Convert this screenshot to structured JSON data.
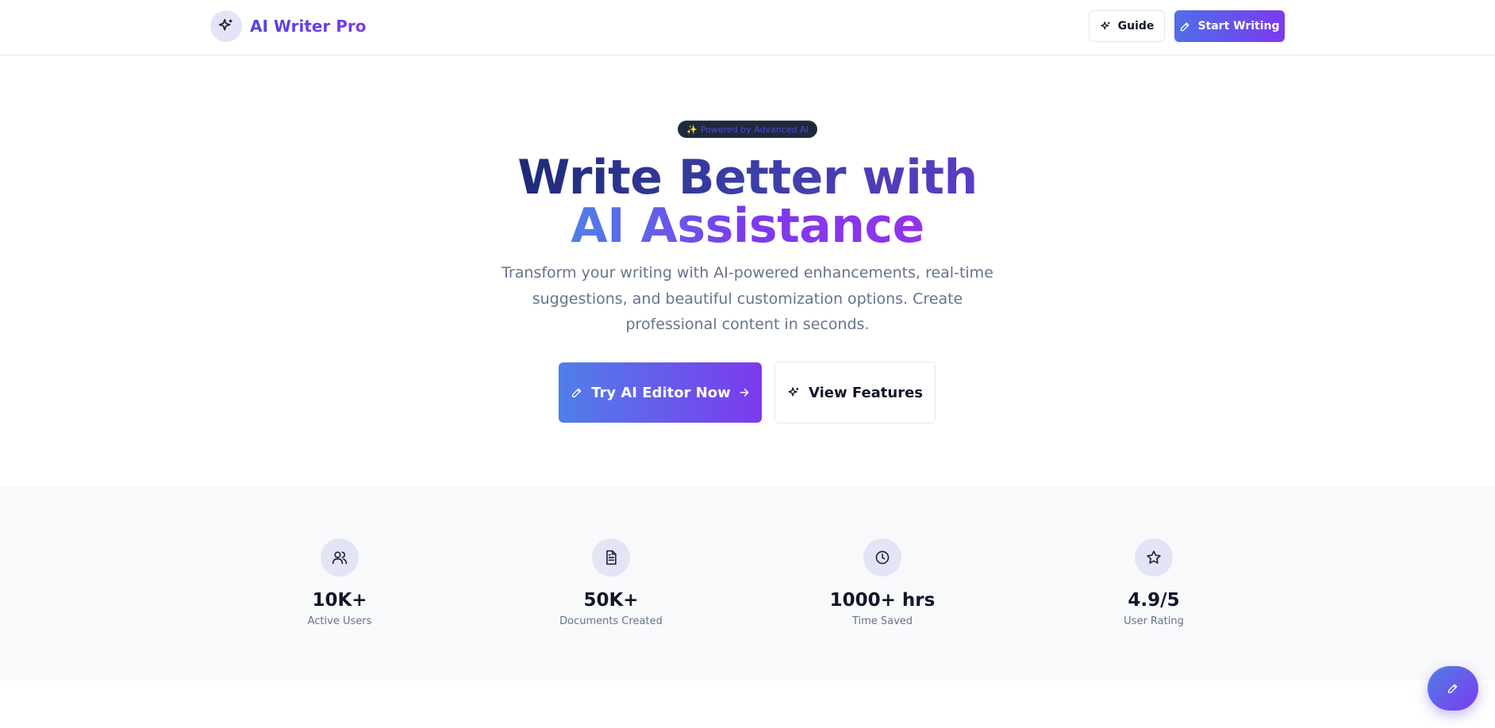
{
  "header": {
    "brand_name": "AI Writer Pro",
    "brand_icon": "sparkles-icon",
    "guide_label": "Guide",
    "guide_icon": "sparkles-icon",
    "start_label": "Start Writing",
    "start_icon": "pen-icon"
  },
  "hero": {
    "badge_icon": "✨",
    "badge_text": "Powered by Advanced AI",
    "title_line1": "Write Better with",
    "title_line2": "AI Assistance",
    "subtitle": "Transform your writing with AI-powered enhancements, real-time suggestions, and beautiful customization options. Create professional content in seconds.",
    "primary_cta": "Try AI Editor Now",
    "secondary_cta": "View Features"
  },
  "stats": [
    {
      "value": "10K+",
      "label": "Active Users",
      "icon": "users-icon"
    },
    {
      "value": "50K+",
      "label": "Documents Created",
      "icon": "document-icon"
    },
    {
      "value": "1000+ hrs",
      "label": "Time Saved",
      "icon": "clock-icon"
    },
    {
      "value": "4.9/5",
      "label": "User Rating",
      "icon": "star-icon"
    }
  ],
  "fab": {
    "icon": "pen-icon"
  },
  "colors": {
    "accent_start": "#4f7fe8",
    "accent_end": "#7c3aed",
    "brand": "#4f46e5",
    "muted_text": "#64748b",
    "icon_bg": "#e4e4f7",
    "stats_bg": "#f8f9fb"
  }
}
